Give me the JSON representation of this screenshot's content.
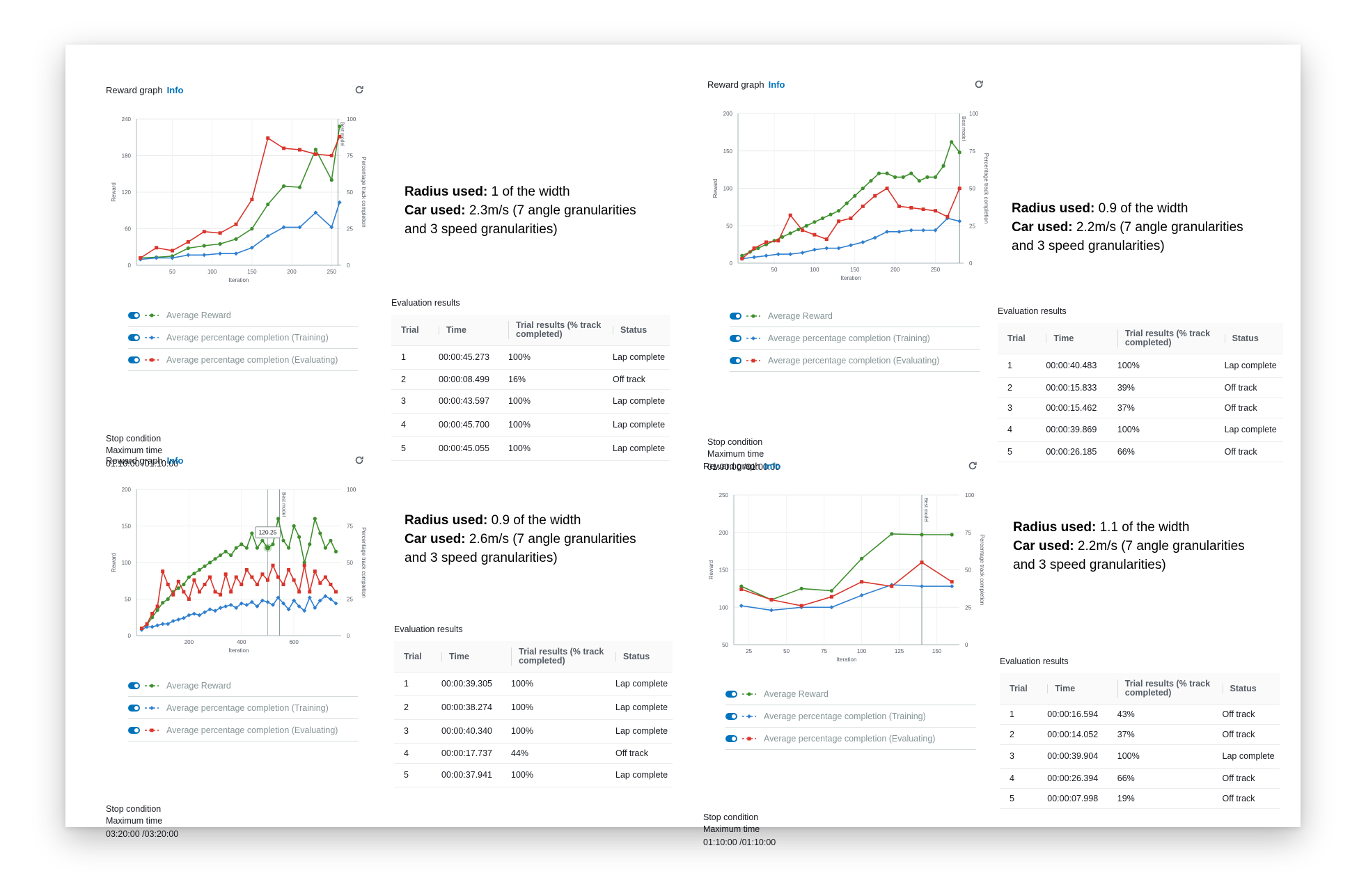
{
  "common": {
    "graph_title": "Reward graph",
    "info_link": "Info",
    "left_axis_label": "Reward",
    "right_axis_label": "Percentage track completion",
    "x_axis_label": "Iteration",
    "best_model_label": "Best model",
    "legend": [
      "Average Reward",
      "Average percentage completion (Training)",
      "Average percentage completion (Evaluating)"
    ],
    "stop_condition": "Stop condition",
    "max_time_label": "Maximum time",
    "eval_title": "Evaluation results",
    "columns": [
      "Trial",
      "Time",
      "Trial results (% track completed)",
      "Status"
    ],
    "radius_label": "Radius used:",
    "car_label": "Car used:",
    "colors": {
      "reward": "#3f8f2e",
      "training": "#2f7fd0",
      "evaluating": "#d9342b",
      "accent": "#0073bb"
    }
  },
  "panels": [
    {
      "radius_value": "1 of the width",
      "car_line1": "2.3m/s (7 angle granularities",
      "car_line2": "and 3 speed granularities)",
      "stop_time": "01:10:00 /01:10:00",
      "rows": [
        [
          "1",
          "00:00:45.273",
          "100%",
          "Lap complete"
        ],
        [
          "2",
          "00:00:08.499",
          "16%",
          "Off track"
        ],
        [
          "3",
          "00:00:43.597",
          "100%",
          "Lap complete"
        ],
        [
          "4",
          "00:00:45.700",
          "100%",
          "Lap complete"
        ],
        [
          "5",
          "00:00:45.055",
          "100%",
          "Lap complete"
        ]
      ]
    },
    {
      "radius_value": "0.9 of the width",
      "car_line1": "2.2m/s (7 angle granularities",
      "car_line2": "and 3 speed granularities)",
      "stop_time": "01:00:00 /01:00:00",
      "rows": [
        [
          "1",
          "00:00:40.483",
          "100%",
          "Lap complete"
        ],
        [
          "2",
          "00:00:15.833",
          "39%",
          "Off track"
        ],
        [
          "3",
          "00:00:15.462",
          "37%",
          "Off track"
        ],
        [
          "4",
          "00:00:39.869",
          "100%",
          "Lap complete"
        ],
        [
          "5",
          "00:00:26.185",
          "66%",
          "Off track"
        ]
      ]
    },
    {
      "radius_value": "0.9 of the width",
      "car_line1": "2.6m/s (7 angle granularities",
      "car_line2": "and 3 speed granularities)",
      "stop_time": "03:20:00 /03:20:00",
      "tooltip": "120.25",
      "rows": [
        [
          "1",
          "00:00:39.305",
          "100%",
          "Lap complete"
        ],
        [
          "2",
          "00:00:38.274",
          "100%",
          "Lap complete"
        ],
        [
          "3",
          "00:00:40.340",
          "100%",
          "Lap complete"
        ],
        [
          "4",
          "00:00:17.737",
          "44%",
          "Off track"
        ],
        [
          "5",
          "00:00:37.941",
          "100%",
          "Lap complete"
        ]
      ]
    },
    {
      "radius_value": "1.1 of the width",
      "car_line1": "2.2m/s (7 angle granularities",
      "car_line2": "and 3 speed granularities)",
      "stop_time": "01:10:00 /01:10:00",
      "rows": [
        [
          "1",
          "00:00:16.594",
          "43%",
          "Off track"
        ],
        [
          "2",
          "00:00:14.052",
          "37%",
          "Off track"
        ],
        [
          "3",
          "00:00:39.904",
          "100%",
          "Lap complete"
        ],
        [
          "4",
          "00:00:26.394",
          "66%",
          "Off track"
        ],
        [
          "5",
          "00:00:07.998",
          "19%",
          "Off track"
        ]
      ]
    }
  ],
  "chart_data": [
    {
      "type": "line",
      "title": "Reward graph",
      "xlabel": "Iteration",
      "ylabel": "Reward",
      "y2label": "Percentage track completion",
      "xlim": [
        5,
        262
      ],
      "ylim": [
        0,
        240
      ],
      "y2lim": [
        0,
        100
      ],
      "xticks": [
        50,
        100,
        150,
        200,
        250
      ],
      "yticks": [
        0,
        60,
        120,
        180,
        240
      ],
      "y2ticks": [
        0,
        25,
        50,
        75,
        100
      ],
      "best_model_x": 258,
      "series": [
        {
          "name": "Average Reward",
          "axis": "left",
          "x": [
            10,
            30,
            50,
            70,
            90,
            110,
            130,
            150,
            170,
            190,
            210,
            230,
            250,
            260
          ],
          "y": [
            12,
            13,
            15,
            28,
            32,
            35,
            43,
            60,
            100,
            130,
            128,
            190,
            140,
            228
          ]
        },
        {
          "name": "Average percentage completion (Training)",
          "axis": "right",
          "x": [
            10,
            30,
            50,
            70,
            90,
            110,
            130,
            150,
            170,
            190,
            210,
            230,
            250,
            260
          ],
          "y": [
            4,
            5,
            5,
            7,
            7,
            8,
            8,
            12,
            20,
            26,
            26,
            36,
            26,
            43
          ]
        },
        {
          "name": "Average percentage completion (Evaluating)",
          "axis": "right",
          "x": [
            10,
            30,
            50,
            70,
            90,
            110,
            130,
            150,
            170,
            190,
            210,
            230,
            250,
            260
          ],
          "y": [
            5,
            12,
            10,
            16,
            23,
            22,
            28,
            45,
            87,
            80,
            79,
            76,
            75,
            88
          ]
        }
      ]
    },
    {
      "type": "line",
      "title": "Reward graph",
      "xlabel": "Iteration",
      "ylabel": "Reward",
      "y2label": "Percentage track completion",
      "xlim": [
        5,
        285
      ],
      "ylim": [
        0,
        200
      ],
      "y2lim": [
        0,
        100
      ],
      "xticks": [
        50,
        100,
        150,
        200,
        250
      ],
      "yticks": [
        0,
        50,
        100,
        150,
        200
      ],
      "y2ticks": [
        0,
        25,
        50,
        75,
        100
      ],
      "best_model_x": 280,
      "series": [
        {
          "name": "Average Reward",
          "axis": "left",
          "x": [
            10,
            20,
            30,
            40,
            50,
            60,
            70,
            80,
            90,
            100,
            110,
            120,
            130,
            140,
            150,
            160,
            170,
            180,
            190,
            200,
            210,
            220,
            230,
            240,
            250,
            260,
            270,
            280
          ],
          "y": [
            10,
            15,
            20,
            25,
            30,
            35,
            40,
            45,
            50,
            55,
            60,
            65,
            70,
            80,
            90,
            100,
            110,
            120,
            120,
            115,
            115,
            120,
            110,
            115,
            115,
            130,
            162,
            148
          ]
        },
        {
          "name": "Average percentage completion (Training)",
          "axis": "right",
          "x": [
            10,
            25,
            40,
            55,
            70,
            85,
            100,
            115,
            130,
            145,
            160,
            175,
            190,
            205,
            220,
            235,
            250,
            265,
            280
          ],
          "y": [
            3,
            4,
            5,
            6,
            6,
            7,
            9,
            10,
            10,
            12,
            14,
            17,
            21,
            21,
            22,
            22,
            22,
            30,
            28
          ]
        },
        {
          "name": "Average percentage completion (Evaluating)",
          "axis": "right",
          "x": [
            10,
            25,
            40,
            55,
            70,
            85,
            100,
            115,
            130,
            145,
            160,
            175,
            190,
            205,
            220,
            235,
            250,
            265,
            280
          ],
          "y": [
            3,
            10,
            14,
            15,
            32,
            22,
            19,
            16,
            28,
            30,
            38,
            45,
            50,
            38,
            37,
            36,
            35,
            31,
            50
          ]
        }
      ]
    },
    {
      "type": "line",
      "title": "Reward graph",
      "xlabel": "Iteration",
      "ylabel": "Reward",
      "y2label": "Percentage track completion",
      "xlim": [
        0,
        780
      ],
      "ylim": [
        0,
        200
      ],
      "y2lim": [
        0,
        100
      ],
      "xticks": [
        200,
        400,
        600
      ],
      "yticks": [
        0,
        50,
        100,
        150,
        200
      ],
      "y2ticks": [
        0,
        25,
        50,
        75,
        100
      ],
      "best_model_x": 545,
      "hover_x": 500,
      "tooltip_value": 120.25,
      "series": [
        {
          "name": "Average Reward",
          "axis": "left",
          "x": [
            20,
            40,
            60,
            80,
            100,
            120,
            140,
            160,
            180,
            200,
            220,
            240,
            260,
            280,
            300,
            320,
            340,
            360,
            380,
            400,
            420,
            440,
            460,
            480,
            500,
            520,
            540,
            560,
            580,
            600,
            620,
            640,
            660,
            680,
            700,
            720,
            740,
            760
          ],
          "y": [
            10,
            15,
            25,
            35,
            45,
            50,
            60,
            65,
            70,
            80,
            85,
            90,
            95,
            100,
            105,
            110,
            115,
            110,
            120,
            125,
            120,
            140,
            120,
            130,
            120,
            125,
            160,
            130,
            120,
            150,
            135,
            100,
            125,
            160,
            140,
            120,
            130,
            115
          ]
        },
        {
          "name": "Average percentage completion (Training)",
          "axis": "right",
          "x": [
            20,
            40,
            60,
            80,
            100,
            120,
            140,
            160,
            180,
            200,
            220,
            240,
            260,
            280,
            300,
            320,
            340,
            360,
            380,
            400,
            420,
            440,
            460,
            480,
            500,
            520,
            540,
            560,
            580,
            600,
            620,
            640,
            660,
            680,
            700,
            720,
            740,
            760
          ],
          "y": [
            4,
            6,
            6,
            7,
            8,
            8,
            10,
            11,
            12,
            14,
            15,
            14,
            16,
            18,
            17,
            19,
            20,
            21,
            19,
            22,
            21,
            23,
            20,
            24,
            23,
            21,
            26,
            22,
            18,
            24,
            20,
            17,
            26,
            19,
            24,
            27,
            25,
            22
          ]
        },
        {
          "name": "Average percentage completion (Evaluating)",
          "axis": "right",
          "x": [
            20,
            40,
            60,
            80,
            100,
            120,
            140,
            160,
            180,
            200,
            220,
            240,
            260,
            280,
            300,
            320,
            340,
            360,
            380,
            400,
            420,
            440,
            460,
            480,
            500,
            520,
            540,
            560,
            580,
            600,
            620,
            640,
            660,
            680,
            700,
            720,
            740,
            760
          ],
          "y": [
            5,
            8,
            15,
            20,
            44,
            35,
            28,
            37,
            30,
            25,
            38,
            30,
            35,
            40,
            30,
            28,
            42,
            30,
            40,
            35,
            45,
            40,
            35,
            42,
            38,
            48,
            40,
            35,
            45,
            38,
            30,
            48,
            30,
            44,
            36,
            40,
            35,
            30
          ]
        }
      ]
    },
    {
      "type": "line",
      "title": "Reward graph",
      "xlabel": "Iteration",
      "ylabel": "Reward",
      "y2label": "Percentage track completion",
      "xlim": [
        15,
        165
      ],
      "ylim": [
        50,
        250
      ],
      "y2lim": [
        0,
        100
      ],
      "xticks": [
        25,
        50,
        75,
        100,
        125,
        150
      ],
      "yticks": [
        50,
        100,
        150,
        200,
        250
      ],
      "y2ticks": [
        0,
        25,
        50,
        75,
        100
      ],
      "best_model_x": 140,
      "series": [
        {
          "name": "Average Reward",
          "axis": "left",
          "x": [
            20,
            40,
            60,
            80,
            100,
            120,
            140,
            160
          ],
          "y": [
            128,
            110,
            125,
            122,
            165,
            198,
            197,
            197
          ]
        },
        {
          "name": "Average percentage completion (Training)",
          "axis": "right",
          "x": [
            20,
            40,
            60,
            80,
            100,
            120,
            140,
            160
          ],
          "y": [
            26,
            23,
            25,
            25,
            33,
            40,
            39,
            39
          ]
        },
        {
          "name": "Average percentage completion (Evaluating)",
          "axis": "right",
          "x": [
            20,
            40,
            60,
            80,
            100,
            120,
            140,
            160
          ],
          "y": [
            37,
            30,
            26,
            32,
            42,
            39,
            55,
            42
          ]
        }
      ]
    }
  ]
}
